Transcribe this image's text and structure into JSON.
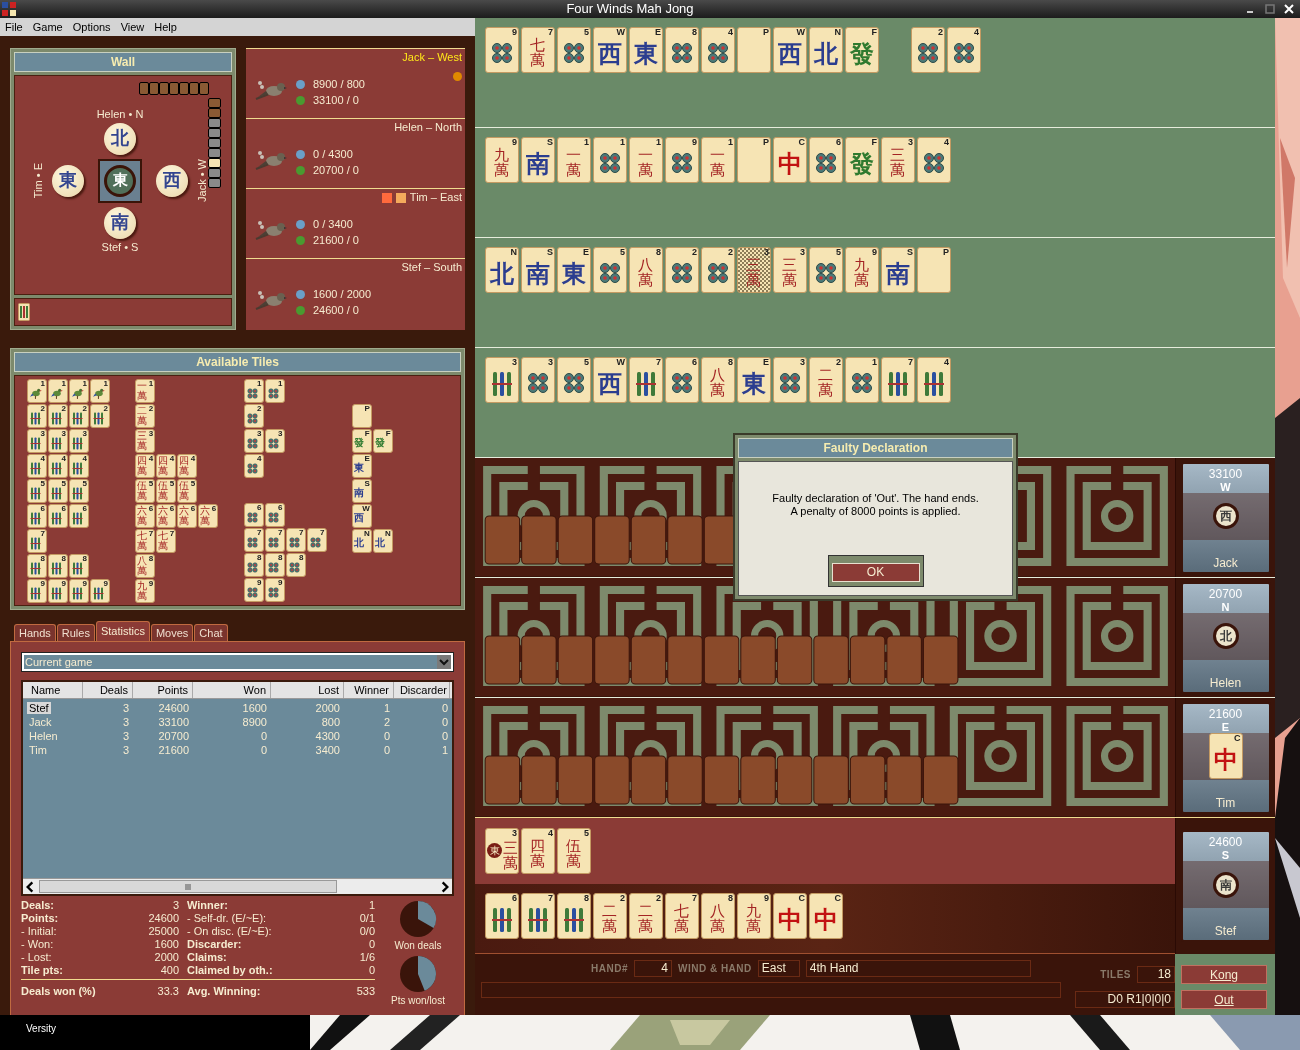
{
  "window": {
    "title": "Four Winds Mah Jong"
  },
  "menu": [
    "File",
    "Game",
    "Options",
    "View",
    "Help"
  ],
  "wall_panel": {
    "title": "Wall",
    "compass": [
      {
        "label": "Helen • N",
        "symbol": "北"
      },
      {
        "label": "Tim • E",
        "symbol": "東"
      },
      {
        "label": "Jack • W",
        "symbol": "西"
      },
      {
        "label": "Stef • S",
        "symbol": "南"
      }
    ],
    "center_symbol": "東",
    "wall_top": [
      {
        "kind": "stacked"
      },
      {
        "kind": "stacked"
      },
      {
        "kind": "stacked"
      },
      {
        "kind": "stacked"
      },
      {
        "kind": "stacked"
      },
      {
        "kind": "stacked"
      },
      {
        "kind": "stacked"
      }
    ],
    "wall_side": [
      {
        "kind": "stacked"
      },
      {
        "kind": "stacked"
      },
      {
        "kind": "drawn"
      },
      {
        "kind": "drawn"
      },
      {
        "kind": "drawn"
      },
      {
        "kind": "drawn"
      },
      {
        "kind": "current"
      },
      {
        "kind": "drawn"
      },
      {
        "kind": "drawn"
      }
    ]
  },
  "players": [
    {
      "name": "Jack – West",
      "current": true,
      "won_lost": "8900 / 800",
      "points": "33100 / 0",
      "markers": [
        {
          "kind": "dot",
          "color": "#e08a00"
        }
      ]
    },
    {
      "name": "Helen – North",
      "current": false,
      "won_lost": "0 / 4300",
      "points": "20700 / 0"
    },
    {
      "name": "Tim – East",
      "current": false,
      "won_lost": "0 / 3400",
      "points": "21600 / 0",
      "markers": [
        {
          "kind": "square",
          "color": "#ff6a3d"
        },
        {
          "kind": "square",
          "color": "#f4aa5c"
        }
      ]
    },
    {
      "name": "Stef – South",
      "current": false,
      "won_lost": "1600 / 2000",
      "points": "24600 / 0"
    }
  ],
  "available_tiles": {
    "title": "Available Tiles",
    "groups": [
      {
        "blocks": [
          [
            [
              {
                "corner": "1",
                "kind": "bird"
              },
              {
                "corner": "1",
                "kind": "bird"
              },
              {
                "corner": "1",
                "kind": "bird"
              },
              {
                "corner": "1",
                "kind": "bird"
              }
            ],
            [
              {
                "corner": "2",
                "kind": "bamboo"
              },
              {
                "corner": "2",
                "kind": "bamboo"
              },
              {
                "corner": "2",
                "kind": "bamboo"
              },
              {
                "corner": "2",
                "kind": "bamboo"
              }
            ],
            [
              {
                "corner": "3",
                "kind": "bamboo"
              },
              {
                "corner": "3",
                "kind": "bamboo"
              },
              {
                "corner": "3",
                "kind": "bamboo"
              }
            ],
            [
              {
                "corner": "4",
                "kind": "bamboo"
              },
              {
                "corner": "4",
                "kind": "bamboo"
              },
              {
                "corner": "4",
                "kind": "bamboo"
              }
            ],
            [
              {
                "corner": "5",
                "kind": "bamboo"
              },
              {
                "corner": "5",
                "kind": "bamboo"
              },
              {
                "corner": "5",
                "kind": "bamboo"
              }
            ],
            [
              {
                "corner": "6",
                "kind": "bamboo"
              },
              {
                "corner": "6",
                "kind": "bamboo"
              },
              {
                "corner": "6",
                "kind": "bamboo"
              }
            ],
            [
              {
                "corner": "7",
                "kind": "bamboo"
              }
            ],
            [
              {
                "corner": "8",
                "kind": "bamboo"
              },
              {
                "corner": "8",
                "kind": "bamboo"
              },
              {
                "corner": "8",
                "kind": "bamboo"
              }
            ],
            [
              {
                "corner": "9",
                "kind": "bamboo"
              },
              {
                "corner": "9",
                "kind": "bamboo"
              },
              {
                "corner": "9",
                "kind": "bamboo"
              },
              {
                "corner": "9",
                "kind": "bamboo"
              }
            ]
          ]
        ]
      },
      {
        "blocks": [
          [
            [
              {
                "corner": "1",
                "kind": "characters",
                "face": "一萬"
              }
            ],
            [
              {
                "corner": "2",
                "kind": "characters",
                "face": "二萬"
              }
            ],
            [
              {
                "corner": "3",
                "kind": "characters",
                "face": "三萬"
              }
            ],
            [
              {
                "corner": "4",
                "kind": "characters",
                "face": "四萬"
              },
              {
                "corner": "4",
                "kind": "characters",
                "face": "四萬"
              },
              {
                "corner": "4",
                "kind": "characters",
                "face": "四萬"
              }
            ],
            [
              {
                "corner": "5",
                "kind": "characters",
                "face": "伍萬"
              },
              {
                "corner": "5",
                "kind": "characters",
                "face": "伍萬"
              },
              {
                "corner": "5",
                "kind": "characters",
                "face": "伍萬"
              }
            ],
            [
              {
                "corner": "6",
                "kind": "characters",
                "face": "六萬"
              },
              {
                "corner": "6",
                "kind": "characters",
                "face": "六萬"
              },
              {
                "corner": "6",
                "kind": "characters",
                "face": "六萬"
              },
              {
                "corner": "6",
                "kind": "characters",
                "face": "六萬"
              }
            ],
            [
              {
                "corner": "7",
                "kind": "characters",
                "face": "七萬"
              },
              {
                "corner": "7",
                "kind": "characters",
                "face": "七萬"
              }
            ],
            [
              {
                "corner": "8",
                "kind": "characters",
                "face": "八萬"
              }
            ],
            [
              {
                "corner": "9",
                "kind": "characters",
                "face": "九萬"
              }
            ]
          ]
        ]
      },
      {
        "blocks": [
          [
            [
              {
                "corner": "1",
                "kind": "dots"
              },
              {
                "corner": "1",
                "kind": "dots"
              }
            ],
            [
              {
                "corner": "2",
                "kind": "dots"
              }
            ],
            [
              {
                "corner": "3",
                "kind": "dots"
              },
              {
                "corner": "3",
                "kind": "dots"
              }
            ],
            [
              {
                "corner": "4",
                "kind": "dots"
              }
            ]
          ],
          [
            [
              {
                "corner": "6",
                "kind": "dots"
              },
              {
                "corner": "6",
                "kind": "dots"
              }
            ],
            [
              {
                "corner": "7",
                "kind": "dots"
              },
              {
                "corner": "7",
                "kind": "dots"
              },
              {
                "corner": "7",
                "kind": "dots"
              },
              {
                "corner": "7",
                "kind": "dots"
              }
            ],
            [
              {
                "corner": "8",
                "kind": "dots"
              },
              {
                "corner": "8",
                "kind": "dots"
              },
              {
                "corner": "8",
                "kind": "dots"
              }
            ],
            [
              {
                "corner": "9",
                "kind": "dots"
              },
              {
                "corner": "9",
                "kind": "dots"
              }
            ]
          ]
        ]
      },
      {
        "blocks": [
          [
            [
              {
                "corner": "P",
                "kind": "flower"
              }
            ],
            [
              {
                "corner": "F",
                "kind": "green",
                "face": "發"
              },
              {
                "corner": "F",
                "kind": "green",
                "face": "發"
              }
            ],
            [
              {
                "corner": "E",
                "kind": "wind",
                "face": "東"
              }
            ],
            [
              {
                "corner": "S",
                "kind": "wind",
                "face": "南"
              }
            ],
            [
              {
                "corner": "W",
                "kind": "wind",
                "face": "西"
              }
            ],
            [
              {
                "corner": "N",
                "kind": "wind",
                "face": "北"
              },
              {
                "corner": "N",
                "kind": "wind",
                "face": "北"
              }
            ]
          ]
        ]
      }
    ]
  },
  "tabs": [
    {
      "label": "Hands",
      "selected": false
    },
    {
      "label": "Rules",
      "selected": false
    },
    {
      "label": "Statistics",
      "selected": true
    },
    {
      "label": "Moves",
      "selected": false
    },
    {
      "label": "Chat",
      "selected": false
    }
  ],
  "statistics": {
    "scope": "Current game",
    "columns": [
      "Name",
      "Deals",
      "Points",
      "Won",
      "Lost",
      "Winner",
      "Discarder"
    ],
    "rows": [
      {
        "cells": [
          "Stef",
          "3",
          "24600",
          "1600",
          "2000",
          "1",
          "0"
        ],
        "selected": true
      },
      {
        "cells": [
          "Jack",
          "3",
          "33100",
          "8900",
          "800",
          "2",
          "0"
        ],
        "selected": false
      },
      {
        "cells": [
          "Helen",
          "3",
          "20700",
          "0",
          "4300",
          "0",
          "0"
        ],
        "selected": false
      },
      {
        "cells": [
          "Tim",
          "3",
          "21600",
          "0",
          "3400",
          "0",
          "1"
        ],
        "selected": false
      }
    ],
    "summary_left": [
      {
        "label": "Deals:",
        "value": "3",
        "bold": true
      },
      {
        "label": "Points:",
        "value": "24600",
        "bold": true
      },
      {
        "label": "- Initial:",
        "value": "25000",
        "bold": false
      },
      {
        "label": "- Won:",
        "value": "1600",
        "bold": false
      },
      {
        "label": "- Lost:",
        "value": "2000",
        "bold": false
      },
      {
        "label": "Tile pts:",
        "value": "400",
        "bold": true
      }
    ],
    "summary_right": [
      {
        "label": "Winner:",
        "value": "1",
        "bold": true
      },
      {
        "label": "- Self-dr. (E/~E):",
        "value": "0/1",
        "bold": false
      },
      {
        "label": "- On disc. (E/~E):",
        "value": "0/0",
        "bold": false
      },
      {
        "label": "Discarder:",
        "value": "0",
        "bold": true
      },
      {
        "label": "Claims:",
        "value": "1/6",
        "bold": true
      },
      {
        "label": "Claimed by oth.:",
        "value": "0",
        "bold": true
      }
    ],
    "footer": [
      {
        "label": "Deals won (%)",
        "value": "33.3"
      },
      {
        "label": "Avg. Winning:",
        "value": "533"
      }
    ],
    "pie_captions": [
      "Won deals",
      "Pts won/lost"
    ]
  },
  "hand_rows": [
    {
      "groups": [
        [
          {
            "corner": "9",
            "kind": "dots",
            "selected": false
          },
          {
            "corner": "7",
            "kind": "characters",
            "face": "七萬",
            "selected": false
          },
          {
            "corner": "5",
            "kind": "dots",
            "selected": false
          },
          {
            "corner": "W",
            "kind": "wind",
            "face": "西",
            "selected": false
          },
          {
            "corner": "E",
            "kind": "wind",
            "face": "東",
            "selected": false
          },
          {
            "corner": "8",
            "kind": "dots",
            "selected": false
          },
          {
            "corner": "4",
            "kind": "dots",
            "selected": false
          },
          {
            "corner": "P",
            "kind": "flower",
            "selected": false
          },
          {
            "corner": "W",
            "kind": "wind",
            "face": "西",
            "selected": false
          },
          {
            "corner": "N",
            "kind": "wind",
            "face": "北",
            "selected": false
          },
          {
            "corner": "F",
            "kind": "green",
            "face": "發",
            "selected": false
          }
        ],
        [
          {
            "corner": "2",
            "kind": "dots",
            "selected": false
          },
          {
            "corner": "4",
            "kind": "dots",
            "selected": false
          }
        ]
      ]
    },
    {
      "groups": [
        [
          {
            "corner": "9",
            "kind": "characters",
            "face": "九萬",
            "selected": false
          },
          {
            "corner": "S",
            "kind": "wind",
            "face": "南",
            "selected": false
          },
          {
            "corner": "1",
            "kind": "characters",
            "face": "一萬",
            "selected": false
          },
          {
            "corner": "1",
            "kind": "dots",
            "selected": false
          },
          {
            "corner": "1",
            "kind": "characters",
            "face": "一萬",
            "selected": false
          },
          {
            "corner": "9",
            "kind": "dots",
            "selected": false
          },
          {
            "corner": "1",
            "kind": "characters",
            "face": "一萬",
            "selected": false
          },
          {
            "corner": "P",
            "kind": "flower",
            "selected": false
          },
          {
            "corner": "C",
            "kind": "red",
            "face": "中",
            "selected": false
          },
          {
            "corner": "6",
            "kind": "dots",
            "selected": false
          },
          {
            "corner": "F",
            "kind": "green",
            "face": "發",
            "selected": false
          },
          {
            "corner": "3",
            "kind": "characters",
            "face": "三萬",
            "selected": false
          },
          {
            "corner": "4",
            "kind": "dots",
            "selected": false
          }
        ]
      ]
    },
    {
      "groups": [
        [
          {
            "corner": "N",
            "kind": "wind",
            "face": "北",
            "selected": false
          },
          {
            "corner": "S",
            "kind": "wind",
            "face": "南",
            "selected": false
          },
          {
            "corner": "E",
            "kind": "wind",
            "face": "東",
            "selected": false
          },
          {
            "corner": "5",
            "kind": "dots",
            "selected": false
          },
          {
            "corner": "8",
            "kind": "characters",
            "face": "八萬",
            "selected": false
          },
          {
            "corner": "2",
            "kind": "dots",
            "selected": false
          },
          {
            "corner": "2",
            "kind": "dots",
            "selected": false
          },
          {
            "corner": "3",
            "kind": "characters",
            "face": "三萬",
            "selected": true
          },
          {
            "corner": "3",
            "kind": "characters",
            "face": "三萬",
            "selected": false
          },
          {
            "corner": "5",
            "kind": "dots",
            "selected": false
          },
          {
            "corner": "9",
            "kind": "characters",
            "face": "九萬",
            "selected": false
          },
          {
            "corner": "S",
            "kind": "wind",
            "face": "南",
            "selected": false
          },
          {
            "corner": "P",
            "kind": "flower",
            "selected": false
          }
        ]
      ]
    },
    {
      "groups": [
        [
          {
            "corner": "3",
            "kind": "bamboo",
            "selected": false
          },
          {
            "corner": "3",
            "kind": "dots",
            "selected": false
          },
          {
            "corner": "5",
            "kind": "dots",
            "selected": false
          },
          {
            "corner": "W",
            "kind": "wind",
            "face": "西",
            "selected": false
          },
          {
            "corner": "7",
            "kind": "bamboo",
            "selected": false
          },
          {
            "corner": "6",
            "kind": "dots",
            "selected": false
          },
          {
            "corner": "8",
            "kind": "characters",
            "face": "八萬",
            "selected": false
          },
          {
            "corner": "E",
            "kind": "wind",
            "face": "東",
            "selected": false
          },
          {
            "corner": "3",
            "kind": "dots",
            "selected": false
          },
          {
            "corner": "2",
            "kind": "characters",
            "face": "二萬",
            "selected": false
          },
          {
            "corner": "1",
            "kind": "dots",
            "selected": false
          },
          {
            "corner": "7",
            "kind": "bamboo",
            "selected": false
          },
          {
            "corner": "4",
            "kind": "bamboo",
            "selected": false
          }
        ]
      ]
    }
  ],
  "opponents": [
    {
      "card": {
        "score": "33100",
        "wind": "W",
        "kind": "disc",
        "symbol": "西",
        "name": "Jack"
      }
    },
    {
      "card": {
        "score": "20700",
        "wind": "N",
        "kind": "disc",
        "symbol": "北",
        "name": "Helen"
      }
    },
    {
      "card": {
        "score": "21600",
        "wind": "E",
        "kind": "tile",
        "tile": {
          "corner": "C",
          "kind": "red",
          "face": "中"
        },
        "name": "Tim"
      }
    }
  ],
  "own_seat": {
    "card": {
      "score": "24600",
      "wind": "S",
      "kind": "disc",
      "symbol": "南",
      "name": "Stef"
    },
    "melds": [
      {
        "corner": "3",
        "kind": "characters",
        "face": "三萬",
        "marker": "東"
      },
      {
        "corner": "4",
        "kind": "characters",
        "face": "四萬"
      },
      {
        "corner": "5",
        "kind": "characters",
        "face": "伍萬"
      }
    ],
    "hand": [
      {
        "corner": "6",
        "kind": "bamboo"
      },
      {
        "corner": "7",
        "kind": "bamboo"
      },
      {
        "corner": "8",
        "kind": "bamboo"
      },
      {
        "corner": "2",
        "kind": "characters",
        "face": "二萬"
      },
      {
        "corner": "2",
        "kind": "characters",
        "face": "二萬"
      },
      {
        "corner": "7",
        "kind": "characters",
        "face": "七萬"
      },
      {
        "corner": "8",
        "kind": "characters",
        "face": "八萬"
      },
      {
        "corner": "9",
        "kind": "characters",
        "face": "九萬"
      },
      {
        "corner": "C",
        "kind": "red",
        "face": "中"
      },
      {
        "corner": "C",
        "kind": "red",
        "face": "中"
      }
    ]
  },
  "status": {
    "hand_label": "HAND#",
    "hand_number": "4",
    "wind_label": "WIND & HAND",
    "wind": "East",
    "hand_name": "4th Hand",
    "tiles_label": "TILES",
    "tiles": "18",
    "code": "D0 R1|0|0|0",
    "buttons": [
      "Kong",
      "Out"
    ]
  },
  "dialog": {
    "title": "Faulty Declaration",
    "message": "Faulty declaration of 'Out'. The hand ends.\nA penalty of 8000 points is applied.",
    "button": "OK"
  },
  "taskbar": {
    "label": "Versity"
  }
}
